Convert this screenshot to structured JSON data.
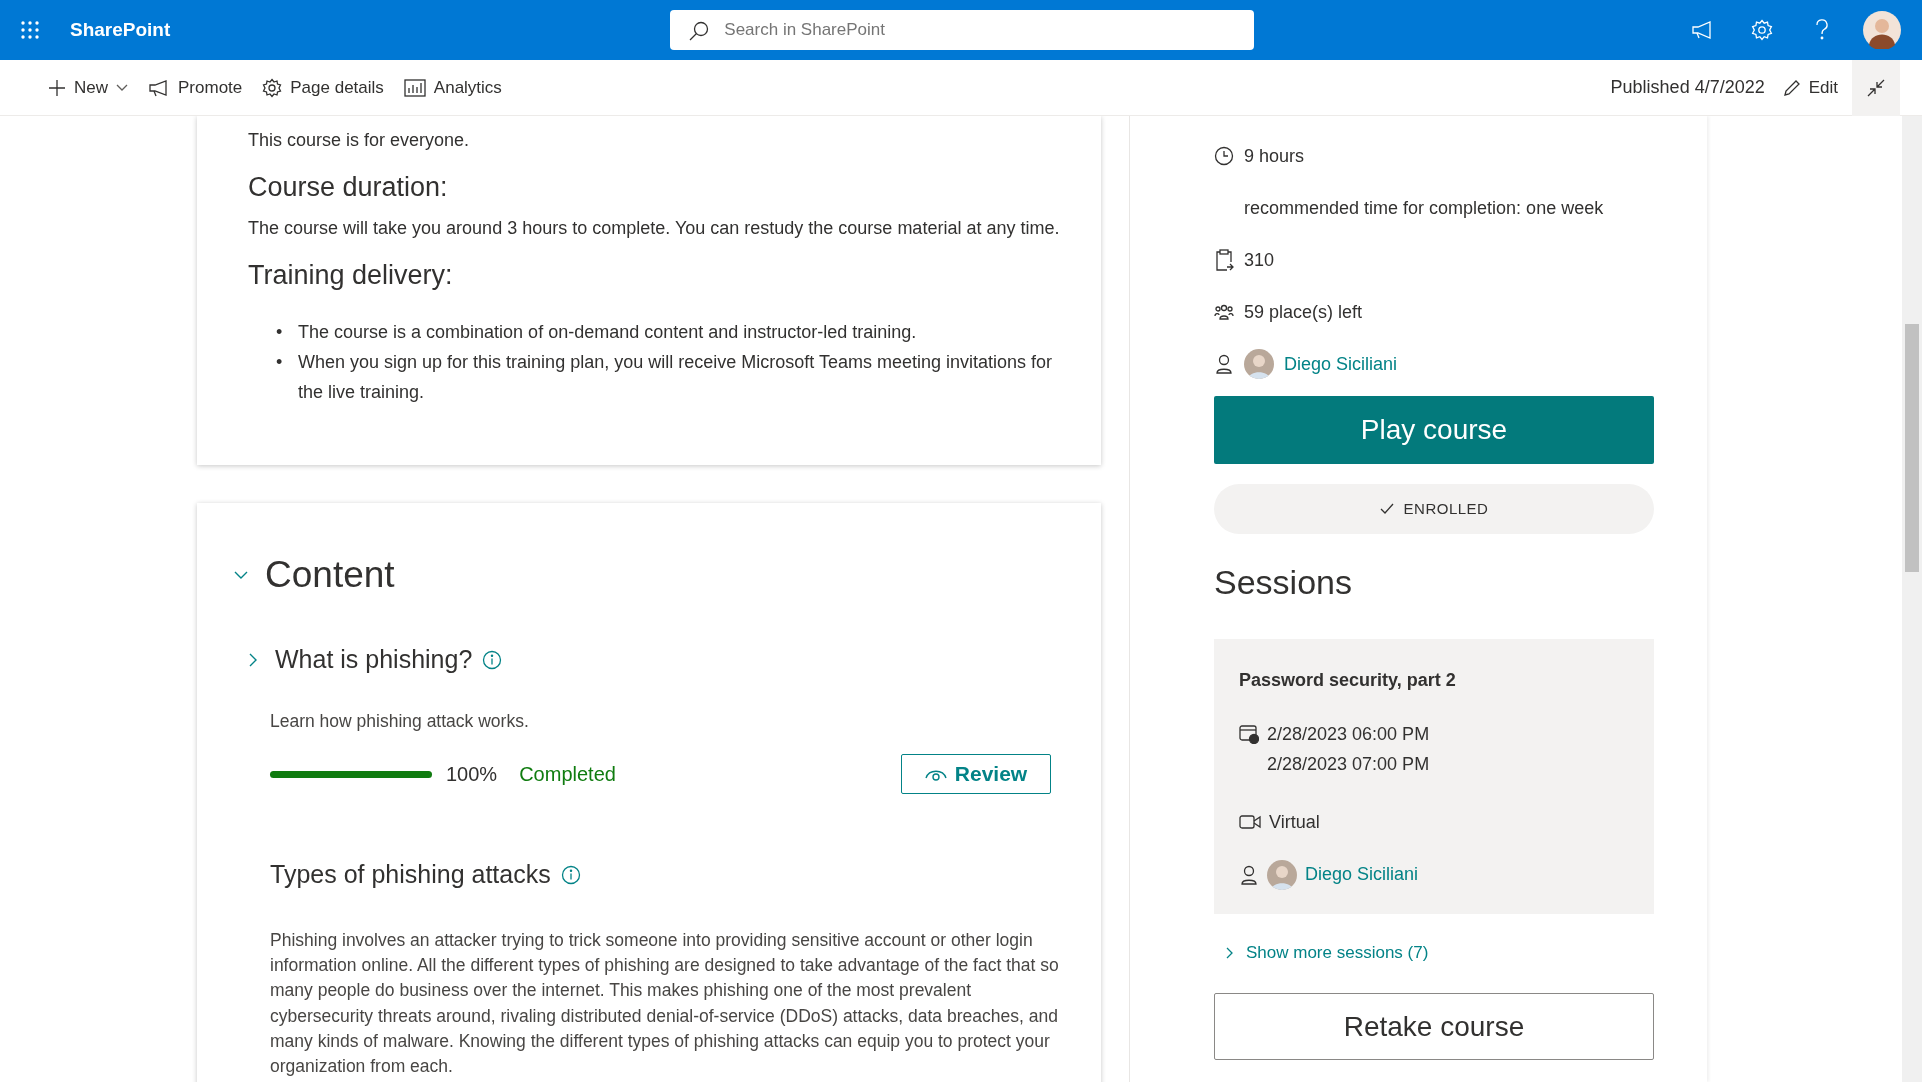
{
  "app_bar": {
    "title": "SharePoint",
    "search": {
      "placeholder": "Search in SharePoint"
    }
  },
  "command_bar": {
    "commands": [
      {
        "label": "New",
        "kind": "plus",
        "has_menu": true
      },
      {
        "label": "Promote",
        "kind": "megaphone",
        "has_menu": false
      },
      {
        "label": "Page details",
        "kind": "gear",
        "has_menu": false
      },
      {
        "label": "Analytics",
        "kind": "chart",
        "has_menu": false
      }
    ],
    "status": "Published 4/7/2022",
    "edit": "Edit"
  },
  "overview": {
    "intro": "This course is for everyone.",
    "sections": [
      {
        "heading": "Course duration:",
        "text": "The course will take you around 3 hours to complete. You can restudy the course material at any time."
      },
      {
        "heading": "Training delivery:",
        "bullets": [
          {
            "marker": "•",
            "text": "The course is a combination of on-demand content and instructor-led training."
          },
          {
            "marker": "•",
            "text": "When you sign up for this training plan, you will receive Microsoft Teams meeting invitations for the live training."
          }
        ]
      }
    ]
  },
  "content": {
    "title": "Content",
    "expanded": true,
    "modules": [
      {
        "title": "What is phishing?",
        "expanded": false,
        "description": "Learn how phishing attack works.",
        "progress": {
          "level": 1,
          "percent": "100%",
          "status": "Completed"
        },
        "action": "Review"
      },
      {
        "title": "Types of phishing attacks",
        "description": "Phishing involves an attacker trying to trick someone into providing sensitive account or other login information online. All the different types of phishing are designed to take advantage of the fact that so many people do business over the internet. This makes phishing one of the most prevalent cybersecurity threats around, rivaling distributed denial-of-service (DDoS) attacks, data breaches, and many kinds of malware. Knowing the different types of phishing attacks can equip you to protect your organization from each."
      }
    ]
  },
  "details": {
    "items": [
      {
        "kind": "duration",
        "text": "9 hours"
      },
      {
        "kind": "note",
        "text": "recommended time for completion: one week"
      },
      {
        "kind": "code",
        "text": "310"
      },
      {
        "kind": "places",
        "text": "59 place(s) left"
      },
      {
        "kind": "person",
        "text": "Diego Siciliani"
      }
    ],
    "play_button": "Play course",
    "enrolled": "ENROLLED"
  },
  "sessions": {
    "title": "Sessions",
    "items": [
      {
        "title": "Password security, part 2",
        "start": "2/28/2023 06:00 PM",
        "end": "2/28/2023 07:00 PM",
        "location": "Virtual",
        "instructor": "Diego Siciliani"
      }
    ],
    "show_more": "Show more sessions (7)"
  },
  "retake_button": "Retake course"
}
